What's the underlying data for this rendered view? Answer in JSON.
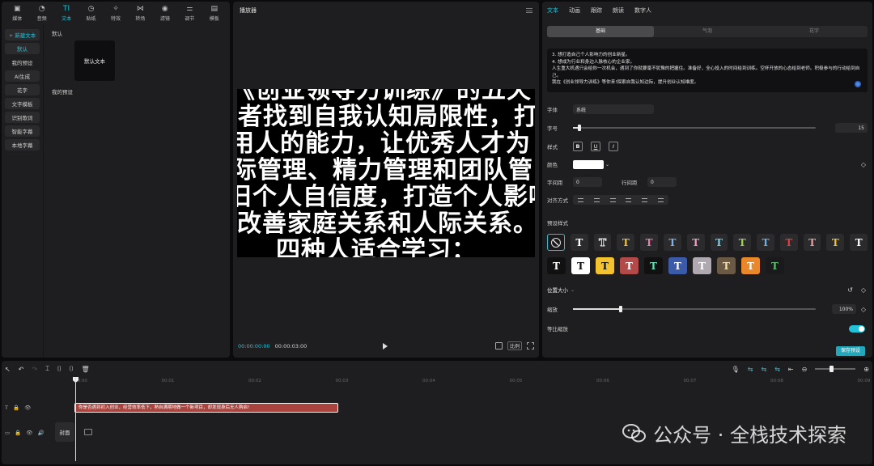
{
  "nav": [
    {
      "label": "媒体",
      "icon": "media-icon"
    },
    {
      "label": "音频",
      "icon": "audio-icon"
    },
    {
      "label": "文本",
      "icon": "text-icon",
      "active": true
    },
    {
      "label": "贴纸",
      "icon": "sticker-icon"
    },
    {
      "label": "特效",
      "icon": "effects-icon"
    },
    {
      "label": "转场",
      "icon": "transition-icon"
    },
    {
      "label": "滤镜",
      "icon": "filter-icon"
    },
    {
      "label": "调节",
      "icon": "adjust-icon"
    },
    {
      "label": "模板",
      "icon": "template-icon"
    }
  ],
  "left_menu": [
    "+ 新建文本",
    "默认",
    "我的预设",
    "AI生成",
    "花字",
    "文字模板",
    "识别歌词",
    "智能字幕",
    "本地字幕"
  ],
  "media": {
    "default_title": "默认",
    "default_tile": "默认文本",
    "my_presets": "我的预设"
  },
  "player": {
    "title": "播放器",
    "lines": [
      "《创业领导力训练》的五天",
      "之者找到自我认知局限性，打",
      "人用人的能力，让优秀人才为",
      "际管理、精力管理和团队管",
      "旧个人自信度，打造个人影响",
      "改善家庭关系和人际关系。",
      "四种人适合学习："
    ],
    "time_current": "00:00:00:00",
    "time_total": "00:00:03:00",
    "ratio": "比例"
  },
  "props": {
    "tabs": [
      "文本",
      "动画",
      "跟踪",
      "朗读",
      "数字人"
    ],
    "subtabs": [
      "基础",
      "气泡",
      "花字"
    ],
    "text_lines": [
      "3. 想打造自己个人影响力的创业新星。",
      "4. 想成为行业和身边人脉核心的企业家。",
      "人生重大机遇只会给你一次机会，遇到了你就要毫不犹豫的把握住。准备好，全心投入的时间给到训练。空杯开放的心态给到老师。积极参与的行动给到自己。",
      "我在《创业领导力训练》等你来!探索自我认知边际，提升创业认知维度。"
    ],
    "font_label": "字体",
    "font_value": "系统",
    "size_label": "字号",
    "size_value": "15",
    "size_fraction": 0.02,
    "style_label": "样式",
    "bold": "B",
    "underline": "U",
    "italic": "I",
    "color_label": "颜色",
    "color_value": "#ffffff",
    "spacing_label": "字间距",
    "spacing_value": "0",
    "line_label": "行间距",
    "line_value": "0",
    "align_label": "对齐方式",
    "preset_title": "预设样式",
    "preset_row1": [
      {
        "c": "#ffffff",
        "bg": "#1a1a1c",
        "t": "none"
      },
      {
        "c": "#ffffff",
        "bg": "#2b2b2e",
        "t": "T"
      },
      {
        "c": "#2b2b2e",
        "bg": "#2b2b2e",
        "t": "T",
        "stroke": "#ddd"
      },
      {
        "c": "#f2c230",
        "bg": "#2b2b2e",
        "t": "T"
      },
      {
        "c": "#f07aa8",
        "bg": "#2b2b2e",
        "t": "T"
      },
      {
        "c": "#7fb2e8",
        "bg": "#2b2b2e",
        "t": "T"
      },
      {
        "c": "#f29bc5",
        "bg": "#2b2b2e",
        "t": "T"
      },
      {
        "c": "#6fd0f0",
        "bg": "#2b2b2e",
        "t": "T"
      },
      {
        "c": "#9fd05a",
        "bg": "#2b2b2e",
        "t": "T"
      },
      {
        "c": "#6fb0e0",
        "bg": "#2b2b2e",
        "t": "T"
      },
      {
        "c": "#e83a3a",
        "bg": "#2b2b2e",
        "t": "T"
      },
      {
        "c": "#e8a0a0",
        "bg": "#2b2b2e",
        "t": "T"
      },
      {
        "c": "#f2c230",
        "bg": "#2b2b2e",
        "t": "T"
      },
      {
        "c": "#ffffff",
        "bg": "#2b2b2e",
        "t": "T"
      }
    ],
    "preset_row2": [
      {
        "c": "#ffffff",
        "bg": "#111"
      },
      {
        "c": "#111",
        "bg": "#ffffff"
      },
      {
        "c": "#111",
        "bg": "#f2c230"
      },
      {
        "c": "#ffffff",
        "bg": "#b34a4a"
      },
      {
        "c": "#5ee0b8",
        "bg": "#111"
      },
      {
        "c": "#ffffff",
        "bg": "#3b5aa8"
      },
      {
        "c": "#ffffff",
        "bg": "#b0a8b0"
      },
      {
        "c": "#f5e0b0",
        "bg": "#6a5a45"
      },
      {
        "c": "#ffffff",
        "bg": "#e8882a"
      },
      {
        "c": "#58c070",
        "bg": "#1a1a1c"
      }
    ],
    "position_label": "位置大小",
    "scale_label": "缩放",
    "scale_value": "100%",
    "ratio_label": "等比缩放",
    "save_preset": "保存预设"
  },
  "timeline": {
    "ruler": [
      "00:00",
      "00:01",
      "00:02",
      "00:03",
      "00:04",
      "00:05",
      "00:06",
      "00:07",
      "00:08",
      "00:09"
    ],
    "clip_text": "你是否遇到初入创业，经营效率低下，熟自满期地做一个新项目，却发现身后无人购启!",
    "cover": "封面"
  },
  "watermark": "公众号 · 全栈技术探索"
}
